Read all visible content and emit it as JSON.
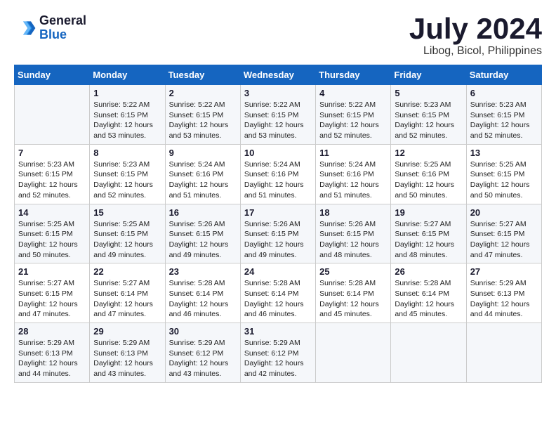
{
  "header": {
    "logo_line1": "General",
    "logo_line2": "Blue",
    "month_year": "July 2024",
    "location": "Libog, Bicol, Philippines"
  },
  "weekdays": [
    "Sunday",
    "Monday",
    "Tuesday",
    "Wednesday",
    "Thursday",
    "Friday",
    "Saturday"
  ],
  "weeks": [
    [
      {
        "day": "",
        "info": ""
      },
      {
        "day": "1",
        "info": "Sunrise: 5:22 AM\nSunset: 6:15 PM\nDaylight: 12 hours\nand 53 minutes."
      },
      {
        "day": "2",
        "info": "Sunrise: 5:22 AM\nSunset: 6:15 PM\nDaylight: 12 hours\nand 53 minutes."
      },
      {
        "day": "3",
        "info": "Sunrise: 5:22 AM\nSunset: 6:15 PM\nDaylight: 12 hours\nand 53 minutes."
      },
      {
        "day": "4",
        "info": "Sunrise: 5:22 AM\nSunset: 6:15 PM\nDaylight: 12 hours\nand 52 minutes."
      },
      {
        "day": "5",
        "info": "Sunrise: 5:23 AM\nSunset: 6:15 PM\nDaylight: 12 hours\nand 52 minutes."
      },
      {
        "day": "6",
        "info": "Sunrise: 5:23 AM\nSunset: 6:15 PM\nDaylight: 12 hours\nand 52 minutes."
      }
    ],
    [
      {
        "day": "7",
        "info": "Sunrise: 5:23 AM\nSunset: 6:15 PM\nDaylight: 12 hours\nand 52 minutes."
      },
      {
        "day": "8",
        "info": "Sunrise: 5:23 AM\nSunset: 6:15 PM\nDaylight: 12 hours\nand 52 minutes."
      },
      {
        "day": "9",
        "info": "Sunrise: 5:24 AM\nSunset: 6:16 PM\nDaylight: 12 hours\nand 51 minutes."
      },
      {
        "day": "10",
        "info": "Sunrise: 5:24 AM\nSunset: 6:16 PM\nDaylight: 12 hours\nand 51 minutes."
      },
      {
        "day": "11",
        "info": "Sunrise: 5:24 AM\nSunset: 6:16 PM\nDaylight: 12 hours\nand 51 minutes."
      },
      {
        "day": "12",
        "info": "Sunrise: 5:25 AM\nSunset: 6:16 PM\nDaylight: 12 hours\nand 50 minutes."
      },
      {
        "day": "13",
        "info": "Sunrise: 5:25 AM\nSunset: 6:15 PM\nDaylight: 12 hours\nand 50 minutes."
      }
    ],
    [
      {
        "day": "14",
        "info": "Sunrise: 5:25 AM\nSunset: 6:15 PM\nDaylight: 12 hours\nand 50 minutes."
      },
      {
        "day": "15",
        "info": "Sunrise: 5:25 AM\nSunset: 6:15 PM\nDaylight: 12 hours\nand 49 minutes."
      },
      {
        "day": "16",
        "info": "Sunrise: 5:26 AM\nSunset: 6:15 PM\nDaylight: 12 hours\nand 49 minutes."
      },
      {
        "day": "17",
        "info": "Sunrise: 5:26 AM\nSunset: 6:15 PM\nDaylight: 12 hours\nand 49 minutes."
      },
      {
        "day": "18",
        "info": "Sunrise: 5:26 AM\nSunset: 6:15 PM\nDaylight: 12 hours\nand 48 minutes."
      },
      {
        "day": "19",
        "info": "Sunrise: 5:27 AM\nSunset: 6:15 PM\nDaylight: 12 hours\nand 48 minutes."
      },
      {
        "day": "20",
        "info": "Sunrise: 5:27 AM\nSunset: 6:15 PM\nDaylight: 12 hours\nand 47 minutes."
      }
    ],
    [
      {
        "day": "21",
        "info": "Sunrise: 5:27 AM\nSunset: 6:15 PM\nDaylight: 12 hours\nand 47 minutes."
      },
      {
        "day": "22",
        "info": "Sunrise: 5:27 AM\nSunset: 6:14 PM\nDaylight: 12 hours\nand 47 minutes."
      },
      {
        "day": "23",
        "info": "Sunrise: 5:28 AM\nSunset: 6:14 PM\nDaylight: 12 hours\nand 46 minutes."
      },
      {
        "day": "24",
        "info": "Sunrise: 5:28 AM\nSunset: 6:14 PM\nDaylight: 12 hours\nand 46 minutes."
      },
      {
        "day": "25",
        "info": "Sunrise: 5:28 AM\nSunset: 6:14 PM\nDaylight: 12 hours\nand 45 minutes."
      },
      {
        "day": "26",
        "info": "Sunrise: 5:28 AM\nSunset: 6:14 PM\nDaylight: 12 hours\nand 45 minutes."
      },
      {
        "day": "27",
        "info": "Sunrise: 5:29 AM\nSunset: 6:13 PM\nDaylight: 12 hours\nand 44 minutes."
      }
    ],
    [
      {
        "day": "28",
        "info": "Sunrise: 5:29 AM\nSunset: 6:13 PM\nDaylight: 12 hours\nand 44 minutes."
      },
      {
        "day": "29",
        "info": "Sunrise: 5:29 AM\nSunset: 6:13 PM\nDaylight: 12 hours\nand 43 minutes."
      },
      {
        "day": "30",
        "info": "Sunrise: 5:29 AM\nSunset: 6:12 PM\nDaylight: 12 hours\nand 43 minutes."
      },
      {
        "day": "31",
        "info": "Sunrise: 5:29 AM\nSunset: 6:12 PM\nDaylight: 12 hours\nand 42 minutes."
      },
      {
        "day": "",
        "info": ""
      },
      {
        "day": "",
        "info": ""
      },
      {
        "day": "",
        "info": ""
      }
    ]
  ]
}
